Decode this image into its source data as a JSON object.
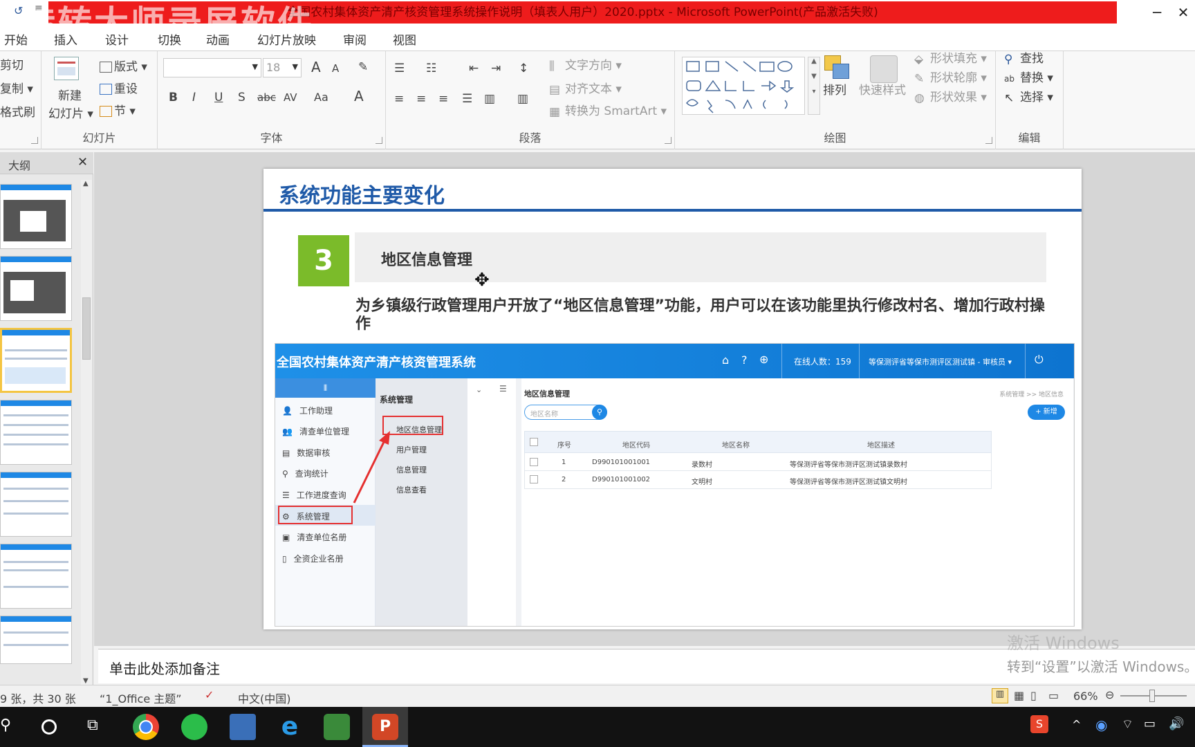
{
  "window": {
    "title": "全国农村集体资产清产核资管理系统操作说明（填表人用户）2020.pptx  -  Microsoft PowerPoint(产品激活失败)",
    "watermark": "转转大师录屏软件",
    "controls": {
      "minimize": "─",
      "close": "✕"
    }
  },
  "tabs": [
    {
      "label": "开始"
    },
    {
      "label": "插入"
    },
    {
      "label": "设计"
    },
    {
      "label": "切换"
    },
    {
      "label": "动画"
    },
    {
      "label": "幻灯片放映"
    },
    {
      "label": "审阅"
    },
    {
      "label": "视图"
    }
  ],
  "ribbon": {
    "clipboard": {
      "cut": "剪切",
      "copy": "复制 ▾",
      "format_painter": "格式刷"
    },
    "slides": {
      "new_slide_1": "新建",
      "new_slide_2": "幻灯片 ▾",
      "layout": "版式 ▾",
      "reset": "重设",
      "section": "节 ▾",
      "label": "幻灯片"
    },
    "font": {
      "font_name": "",
      "font_size": "18",
      "grow": "A",
      "shrink": "A",
      "bold": "B",
      "italic": "I",
      "underline": "U",
      "shadow": "S",
      "strike": "abc",
      "spacing": "AV",
      "case": "Aa",
      "color": "A",
      "label": "字体"
    },
    "paragraph": {
      "text_direction": "文字方向 ▾",
      "align_text": "对齐文本 ▾",
      "smartart": "转换为 SmartArt ▾",
      "label": "段落"
    },
    "drawing": {
      "arrange": "排列",
      "quick_styles": "快速样式",
      "shape_fill": "形状填充 ▾",
      "shape_outline": "形状轮廓 ▾",
      "shape_effects": "形状效果 ▾",
      "label": "绘图"
    },
    "editing": {
      "find": "查找",
      "replace": "替换 ▾",
      "select": "选择 ▾",
      "label": "编辑"
    }
  },
  "left_panel": {
    "tab_label": "大纲",
    "close": "✕"
  },
  "slide": {
    "title": "系统功能主要变化",
    "number": "3",
    "heading": "地区信息管理",
    "description": "为乡镇级行政管理用户开放了“地区信息管理”功能，用户可以在该功能里执行修改村名、增加行政村操作"
  },
  "embedded_app": {
    "title": "全国农村集体资产清产核资管理系统",
    "online_count": "在线人数：159",
    "user": "等保测评省等保市测评区测试镇 - 审核员 ▾",
    "sidebar": [
      "工作助理",
      "清查单位管理",
      "数据审核",
      "查询统计",
      "工作进度查询",
      "系统管理",
      "清查单位名册",
      "全资企业名册"
    ],
    "submenu_title": "系统管理",
    "submenu": [
      "地区信息管理",
      "用户管理",
      "信息管理",
      "信息查看"
    ],
    "page_title": "地区信息管理",
    "breadcrumb": "系统管理 >> 地区信息",
    "search_placeholder": "地区名称",
    "add_button": "+ 新增",
    "columns": [
      "序号",
      "地区代码",
      "地区名称",
      "地区描述"
    ],
    "rows": [
      {
        "index": "1",
        "code": "D990101001001",
        "name": "录数村",
        "desc": "等保测评省等保市测评区测试镇录数村"
      },
      {
        "index": "2",
        "code": "D990101001002",
        "name": "文明村",
        "desc": "等保测评省等保市测评区测试镇文明村"
      }
    ]
  },
  "notes_placeholder": "单击此处添加备注",
  "activation": {
    "line1": "激活 Windows",
    "line2": "转到“设置”以激活 Windows。"
  },
  "status": {
    "slide_info": "9 张，共 30 张",
    "theme": "“1_Office 主题”",
    "language": "中文(中国)",
    "zoom": "66%"
  },
  "taskbar": {
    "icons": [
      "search-icon",
      "cortana-icon",
      "task-view-icon",
      "chrome-icon",
      "360-browser-icon",
      "computer-icon",
      "ie-icon",
      "chart-app-icon",
      "powerpoint-icon"
    ]
  }
}
